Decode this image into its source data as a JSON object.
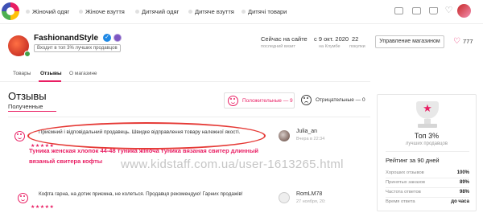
{
  "nav": {
    "tabs": [
      "Жіночий одяг",
      "Жіноче взуття",
      "Дитячий одяг",
      "Дитяче взуття",
      "Дитячі товари"
    ],
    "icons": [
      "settings-icon",
      "mail-icon",
      "bag-icon",
      "heart-icon"
    ]
  },
  "shop": {
    "name": "FashionandStyle",
    "top_badge": "Входит в топ 3% лучших продавцов",
    "online_status": "Сейчас на сайте",
    "online_status_sub": "последний визит",
    "since": "с 9 окт. 2020",
    "since_sub": "на Клумбе",
    "count": "22",
    "count_sub": "покупки",
    "manage_button": "Управление магазином",
    "favorites": "777"
  },
  "subtabs": [
    "Товары",
    "Отзывы",
    "О магазине"
  ],
  "reviews": {
    "title": "Отзывы",
    "received_label": "Полученные",
    "positive_label": "Положительные — 9",
    "negative_label": "Отрицательные — 0",
    "items": [
      {
        "text": "Приємний і відповідальний продавець. Швидке відправлення товару належної якості.",
        "stars": "★★★★★",
        "product": "Туника женская хлопок 44-48 туника жіноча туника вязаная свитер длинный вязаный свитера кофты",
        "author": "Julia_an",
        "date": "Вчера в 22:34"
      },
      {
        "text": "Кофта гарна, на дотик приємна, не колеться. Продавця рекомендую! Гарних продажів!",
        "stars": "★★★★★",
        "product": "",
        "author": "RomLM78",
        "date": "27 ноября, 20:"
      }
    ]
  },
  "watermark": "www.kidstaff.com.ua/user-1613265.html",
  "panel": {
    "top_title": "Топ 3%",
    "top_sub": "лучших продавцов",
    "rating_title": "Рейтинг за 90 дней",
    "metrics": [
      {
        "label": "Хороших отзывов",
        "value": "100%"
      },
      {
        "label": "Принятых заказов",
        "value": "89%"
      },
      {
        "label": "Частота ответов",
        "value": "98%"
      },
      {
        "label": "Время ответа",
        "value": "до часа"
      }
    ]
  },
  "colors": {
    "accent": "#e91e63",
    "highlight": "#e53935"
  }
}
